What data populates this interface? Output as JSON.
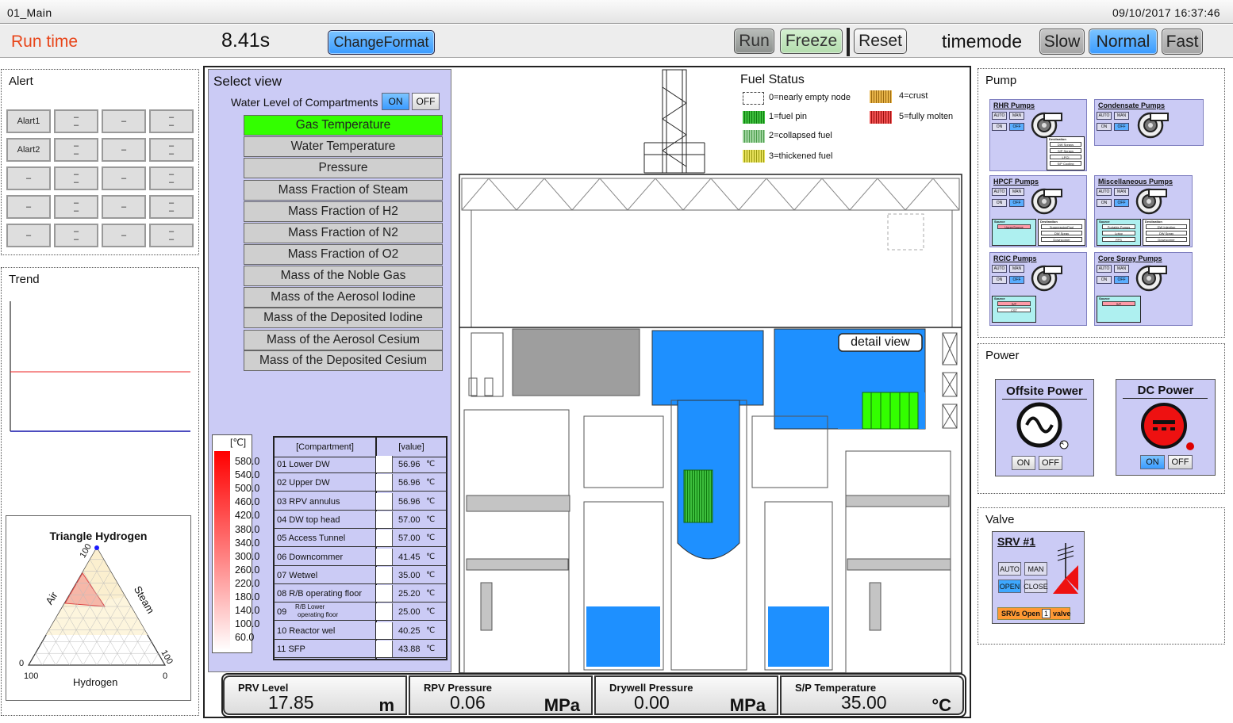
{
  "window": {
    "title": "01_Main",
    "datetime": "09/10/2017 16:37:46"
  },
  "topbar": {
    "runtime_label": "Run time",
    "runtime_value": "8.41s",
    "change_format": "ChangeFormat",
    "run": "Run",
    "freeze": "Freeze",
    "reset": "Reset",
    "timemode_label": "timemode",
    "slow": "Slow",
    "normal": "Normal",
    "fast": "Fast"
  },
  "alert": {
    "title": "Alert",
    "buttons": [
      "Alart1",
      "–\n–",
      "–",
      "–\n–",
      "Alart2",
      "–\n–",
      "–",
      "–\n–",
      "–",
      "–\n–",
      "–",
      "–\n–",
      "–",
      "–\n–",
      "–",
      "–\n–",
      "–",
      "–\n–",
      "–",
      "–\n–"
    ]
  },
  "trend": {
    "title": "Trend"
  },
  "triangle": {
    "title": "Triangle Hydrogen",
    "air": "Air",
    "steam": "Steam",
    "hydrogen": "Hydrogen",
    "t100": "100",
    "t0a": "0",
    "r100": "100",
    "b100": "100",
    "b0": "0"
  },
  "selectview": {
    "title": "Select view",
    "water_level": "Water Level of Compartments",
    "on": "ON",
    "off": "OFF",
    "items": [
      "Gas Temperature",
      "Water Temperature",
      "Pressure",
      "Mass Fraction of Steam",
      "Mass Fraction of H2",
      "Mass Fraction of N2",
      "Mass Fraction of O2",
      "Mass of the Noble Gas",
      "Mass of the Aerosol Iodine",
      "Mass of the Deposited Iodine",
      "Mass of the Aerosol Cesium",
      "Mass of the Deposited Cesium"
    ],
    "selected_index": 0
  },
  "scale": {
    "unit": "[℃]",
    "ticks": [
      "580.0",
      "540.0",
      "500.0",
      "460.0",
      "420.0",
      "380.0",
      "340.0",
      "300.0",
      "260.0",
      "220.0",
      "180.0",
      "140.0",
      "100.0",
      "60.0"
    ]
  },
  "compartments": {
    "header_name": "[Compartment]",
    "header_value": "[value]",
    "unit": "℃",
    "rows": [
      {
        "name": "01 Lower DW",
        "value": "56.96"
      },
      {
        "name": "02 Upper DW",
        "value": "56.96"
      },
      {
        "name": "03 RPV annulus",
        "value": "56.96"
      },
      {
        "name": "04 DW top head",
        "value": "57.00"
      },
      {
        "name": "05 Access Tunnel",
        "value": "57.00"
      },
      {
        "name": "06 Downcommer",
        "value": "41.45"
      },
      {
        "name": "07 Wetwel",
        "value": "35.00"
      },
      {
        "name": "08 R/B operating floor",
        "value": "25.20"
      },
      {
        "name": "09",
        "sub1": "R/B Lower",
        "sub2": "operating floor",
        "value": "25.00"
      },
      {
        "name": "10 Reactor wel",
        "value": "40.25"
      },
      {
        "name": "11 SFP",
        "value": "43.88"
      }
    ]
  },
  "fuel": {
    "title": "Fuel Status",
    "legend": [
      "0=nearly empty node",
      "1=fuel pin",
      "2=collapsed fuel",
      "3=thickened fuel",
      "4=crust",
      "5=fully molten"
    ]
  },
  "diagram": {
    "detail_view": "detail view"
  },
  "gauges": [
    {
      "label": "PRV Level",
      "value": "17.85",
      "unit": "m"
    },
    {
      "label": "RPV Pressure",
      "value": "0.06",
      "unit": "MPa"
    },
    {
      "label": "Drywell Pressure",
      "value": "0.00",
      "unit": "MPa"
    },
    {
      "label": "S/P Temperature",
      "value": "35.00",
      "unit": "°C"
    }
  ],
  "pump": {
    "title": "Pump",
    "boxes": [
      "RHR Pumps",
      "Condensate Pumps",
      "HPCF Pumps",
      "Miscellaneous Pumps",
      "RCIC Pumps",
      "Core Spray Pumps"
    ],
    "auto": "AUTO",
    "man": "MAN",
    "on": "ON",
    "off": "OFF",
    "destination": "Destination",
    "source": "Source",
    "rhr_dest": [
      "DW Sprays",
      "S/P Sprays",
      "LPCI",
      "S/P Cooling"
    ],
    "hpcf_source": [
      "UpperSource"
    ],
    "hpcf_dest": [
      "SuppressionPool",
      "DW Spray",
      "Downcomer"
    ],
    "misc_source": [
      "Portable Pumps",
      "Lptcp",
      "FPS"
    ],
    "misc_dest": [
      "DW Injection",
      "DW Spray",
      "Downcomer"
    ],
    "rcic_source": [
      "S/P",
      "CST"
    ],
    "cs_source": [
      "S/P"
    ]
  },
  "power": {
    "title": "Power",
    "offsite": "Offsite Power",
    "dc": "DC Power",
    "on": "ON",
    "off": "OFF",
    "a_mark": "A"
  },
  "valve": {
    "title": "Valve",
    "srv": "SRV #1",
    "auto": "AUTO",
    "man": "MAN",
    "open": "OPEN",
    "close": "CLOSE",
    "srvs_open": "SRVs Open",
    "count": "1",
    "valve": "valve"
  },
  "colors": {
    "selected": "#33ff00",
    "water": "#1e90ff",
    "fuel": "#33cc33",
    "purple": "#cbcbf5",
    "accent_blue": "#3ea8ff"
  }
}
